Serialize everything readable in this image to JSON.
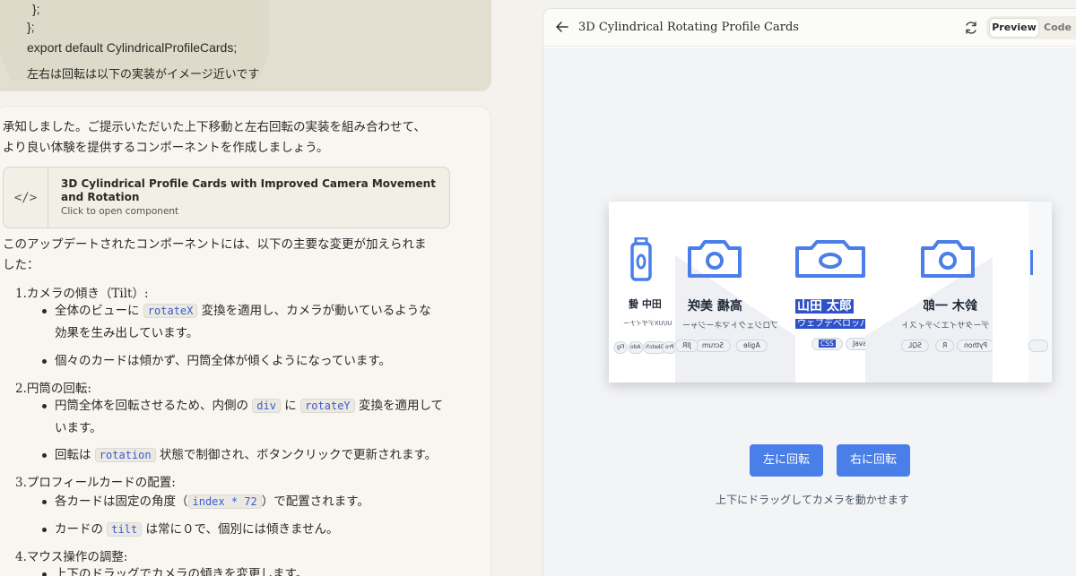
{
  "colors": {
    "accent": "#4a7ee8",
    "card_icon": "#4a7ee8",
    "code_text": "#3a5bd0",
    "highlight": "#2f52c9"
  },
  "chat": {
    "code_lines": [
      "};",
      "};",
      "export default CylindricalProfileCards;"
    ],
    "user_message": "左右は回転は以下の実装がイメージ近いです",
    "intro_1": "承知しました。ご提示いただいた上下移動と左右回転の実装を組み合わせて、",
    "intro_2": "より良い体験を提供するコンポーネントを作成しましょう。",
    "artifact": {
      "icon": "code-icon",
      "icon_glyph": "</>",
      "title": "3D Cylindrical Profile Cards with Improved Camera Movement and Rotation",
      "subtitle": "Click to open component"
    },
    "summary_1": "このアップデートされたコンポーネントには、以下の主要な変更が加えられま",
    "summary_2": "した：",
    "sections": [
      {
        "num": "1.",
        "title": "カメラの傾き（Tilt）:",
        "bullets": [
          {
            "pre": "全体のビューに",
            "code": "rotateX",
            "post": "変換を適用し、カメラが動いているような",
            "cont": "効果を生み出しています。"
          },
          {
            "pre": "個々のカードは傾かず、円筒全体が傾くようになっています。"
          }
        ]
      },
      {
        "num": "2.",
        "title": "円筒の回転:",
        "bullets": [
          {
            "pre": "円筒全体を回転させるため、内側の",
            "code": "div",
            "mid": "に",
            "code2": "rotateY",
            "post": "変換を適用して",
            "cont": "います。"
          },
          {
            "pre": "回転は",
            "code": "rotation",
            "post": "状態で制御され、ボタンクリックで更新されます。"
          }
        ]
      },
      {
        "num": "3.",
        "title": "プロフィールカードの配置:",
        "bullets": [
          {
            "pre": "各カードは固定の角度（",
            "code": "index * 72",
            "post": "）で配置されます。"
          },
          {
            "pre": "カードの",
            "code": "tilt",
            "post": "は常に０で、個別には傾きません。"
          }
        ]
      },
      {
        "num": "4.",
        "title": "マウス操作の調整:",
        "bullets": [
          {
            "pre": "上下のドラッグでカメラの傾きを変更します。"
          }
        ]
      }
    ]
  },
  "preview": {
    "title": "3D Cylindrical Rotating Profile Cards",
    "tabs": {
      "preview": "Preview",
      "code": "Code"
    },
    "cards": [
      {
        "name": "田中 健",
        "role": "UI/UXデザイナー",
        "tags": [
          "Fig",
          "Ado",
          "Sketch",
          "Pro"
        ]
      },
      {
        "name": "高橋 美咲",
        "role": "プロジェクトマネージャー",
        "tags": [
          "Agile",
          "Scrum",
          "JIR"
        ]
      },
      {
        "name": "山田 太郎",
        "role": "ウェブデベロッパー",
        "tags": [
          "CSS",
          "Java"
        ]
      },
      {
        "name": "鈴木 一郎",
        "role": "データサイエンティスト",
        "tags": [
          "Python",
          "R",
          "SQL"
        ]
      }
    ],
    "buttons": {
      "rotate_left": "左に回転",
      "rotate_right": "右に回転"
    },
    "hint": "上下にドラッグしてカメラを動かせます"
  }
}
